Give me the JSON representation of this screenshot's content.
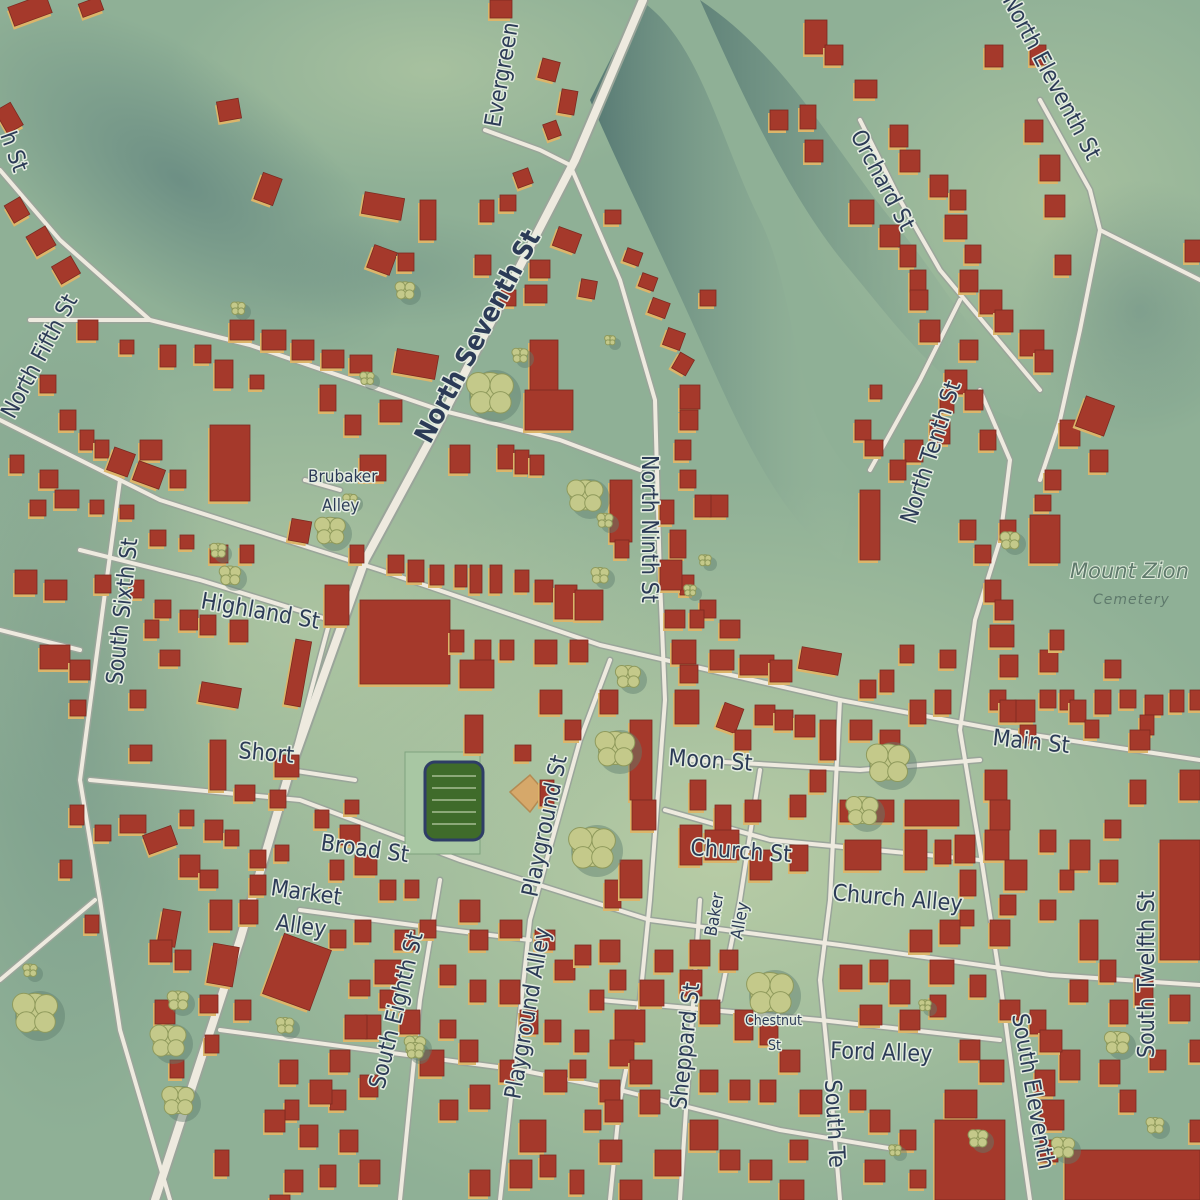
{
  "colors": {
    "terrain_base": "#8fb096",
    "terrain_light": "#b3c9a3",
    "ridge_shadow": "#5b7f79",
    "road_casing": "#9aa59a",
    "road_fill": "#eeeadf",
    "building_fill": "#a5392b",
    "building_shadow": "#dcb56a",
    "tree": "#c4c98a",
    "field": "#3f6b2a",
    "label_text": "#2c3b57"
  },
  "labels": {
    "north_seventh": "North Seventh St",
    "evergreen": "Evergreen",
    "north_eleventh": "North Eleventh St",
    "orchard": "Orchard St",
    "north_fifth": "North Fifth St",
    "north_tenth": "North Tenth St",
    "brubaker1": "Brubaker",
    "brubaker2": "Alley",
    "north_ninth": "North Ninth St",
    "mount_zion": "Mount Zion",
    "cemetery": "Cemetery",
    "south_sixth": "South Sixth St",
    "highland": "Highland St",
    "main": "Main St",
    "short": "Short",
    "playground_st": "Playground St",
    "moon": "Moon St",
    "church_st": "Church St",
    "broad": "Broad St",
    "church_alley": "Church Alley",
    "market1": "Market",
    "market2": "Alley",
    "south_eighth": "South Eighth St",
    "playground_alley": "Playground Alley",
    "baker1": "Baker",
    "baker2": "Alley",
    "south_twelfth": "South Twelfth St",
    "sheppard": "Sheppard St",
    "chestnut1": "Chestnut",
    "chestnut2": "St",
    "ford_alley": "Ford Alley",
    "south_tenth_partial": "South Te",
    "south_eleventh_partial": "South Eleventh",
    "edge_partial": "h St"
  }
}
